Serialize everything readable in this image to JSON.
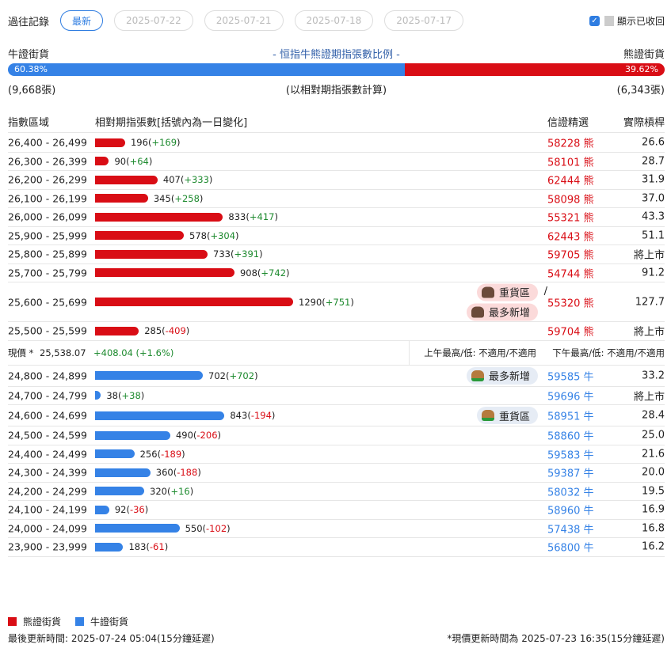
{
  "history": {
    "label": "過往記錄",
    "tabs": [
      "最新",
      "2025-07-22",
      "2025-07-21",
      "2025-07-18",
      "2025-07-17"
    ],
    "show_recalled": "顯示已收回"
  },
  "ratio": {
    "bull_label": "牛證街貨",
    "title": "- 恒指牛熊證期指張數比例 -",
    "bear_label": "熊證街貨",
    "bull_pct": "60.38%",
    "bear_pct": "39.62%",
    "bull_fraction": 0.6038,
    "bull_count": "(9,668張)",
    "note": "(以相對期指張數計算)",
    "bear_count": "(6,343張)"
  },
  "table_header": {
    "range": "指數區域",
    "count": "相對期指張數[括號內為一日變化]",
    "pick": "信證精選",
    "strike": "實際槓桿"
  },
  "colors": {
    "bear": "#d90d15",
    "bull": "#3582e6"
  },
  "bear_rows": [
    {
      "range": "26,400 - 26,499",
      "count": 196,
      "change": "+169",
      "code": "58228",
      "type": "熊",
      "strike": "26.6"
    },
    {
      "range": "26,300 - 26,399",
      "count": 90,
      "change": "+64",
      "code": "58101",
      "type": "熊",
      "strike": "28.7"
    },
    {
      "range": "26,200 - 26,299",
      "count": 407,
      "change": "+333",
      "code": "62444",
      "type": "熊",
      "strike": "31.9"
    },
    {
      "range": "26,100 - 26,199",
      "count": 345,
      "change": "+258",
      "code": "58098",
      "type": "熊",
      "strike": "37.0"
    },
    {
      "range": "26,000 - 26,099",
      "count": 833,
      "change": "+417",
      "code": "55321",
      "type": "熊",
      "strike": "43.3"
    },
    {
      "range": "25,900 - 25,999",
      "count": 578,
      "change": "+304",
      "code": "62443",
      "type": "熊",
      "strike": "51.1"
    },
    {
      "range": "25,800 - 25,899",
      "count": 733,
      "change": "+391",
      "code": "59705",
      "type": "熊",
      "strike": "將上市"
    },
    {
      "range": "25,700 - 25,799",
      "count": 908,
      "change": "+742",
      "code": "54744",
      "type": "熊",
      "strike": "91.2"
    },
    {
      "range": "25,600 - 25,699",
      "count": 1290,
      "change": "+751",
      "code": "55320",
      "type": "熊",
      "strike": "127.7",
      "badges": [
        "重貨區",
        "最多新增"
      ],
      "sep": "/"
    },
    {
      "range": "25,500 - 25,599",
      "count": 285,
      "change": "-409",
      "code": "59704",
      "type": "熊",
      "strike": "將上市"
    }
  ],
  "current": {
    "label": "現價 *",
    "price": "25,538.07",
    "change": "+408.04 (+1.6%)",
    "am": "上午最高/低: 不適用/不適用",
    "pm": "下午最高/低: 不適用/不適用"
  },
  "bull_rows": [
    {
      "range": "24,800 - 24,899",
      "count": 702,
      "change": "+702",
      "code": "59585",
      "type": "牛",
      "strike": "33.2",
      "badges": [
        "最多新增"
      ]
    },
    {
      "range": "24,700 - 24,799",
      "count": 38,
      "change": "+38",
      "code": "59696",
      "type": "牛",
      "strike": "將上市"
    },
    {
      "range": "24,600 - 24,699",
      "count": 843,
      "change": "-194",
      "code": "58951",
      "type": "牛",
      "strike": "28.4",
      "badges": [
        "重貨區"
      ]
    },
    {
      "range": "24,500 - 24,599",
      "count": 490,
      "change": "-206",
      "code": "58860",
      "type": "牛",
      "strike": "25.0"
    },
    {
      "range": "24,400 - 24,499",
      "count": 256,
      "change": "-189",
      "code": "59583",
      "type": "牛",
      "strike": "21.6"
    },
    {
      "range": "24,300 - 24,399",
      "count": 360,
      "change": "-188",
      "code": "59387",
      "type": "牛",
      "strike": "20.0"
    },
    {
      "range": "24,200 - 24,299",
      "count": 320,
      "change": "+16",
      "code": "58032",
      "type": "牛",
      "strike": "19.5"
    },
    {
      "range": "24,100 - 24,199",
      "count": 92,
      "change": "-36",
      "code": "58960",
      "type": "牛",
      "strike": "16.9"
    },
    {
      "range": "24,000 - 24,099",
      "count": 550,
      "change": "-102",
      "code": "57438",
      "type": "牛",
      "strike": "16.8"
    },
    {
      "range": "23,900 - 23,999",
      "count": 183,
      "change": "-61",
      "code": "56800",
      "type": "牛",
      "strike": "16.2"
    }
  ],
  "legend": {
    "bear": "熊證街貨",
    "bull": "牛證街貨"
  },
  "footer": {
    "updated": "最後更新時間: 2025-07-24 05:04(15分鐘延遲)",
    "price_updated": "*現價更新時間為 2025-07-23 16:35(15分鐘延遲)"
  }
}
